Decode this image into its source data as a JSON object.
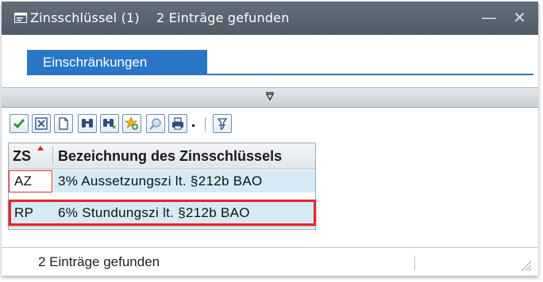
{
  "window": {
    "title": "Zinsschlüssel (1)    2 Einträge gefunden",
    "minimize_glyph": "—",
    "close_glyph": "✕"
  },
  "tabs": [
    {
      "label": "Einschränkungen"
    }
  ],
  "toolbar": {
    "buttons": [
      {
        "icon": "checkmark-icon"
      },
      {
        "icon": "cancel-icon"
      },
      {
        "icon": "new-document-icon"
      },
      {
        "icon": "find-icon"
      },
      {
        "icon": "find-next-icon"
      },
      {
        "icon": "favorite-add-icon"
      },
      {
        "icon": "help-icon"
      },
      {
        "icon": "print-icon"
      },
      {
        "icon": "dropdown-icon"
      },
      {
        "icon": "filter-icon"
      }
    ]
  },
  "table": {
    "columns": [
      "ZS",
      "Bezeichnung des Zinsschlüssels"
    ],
    "rows": [
      {
        "code": "AZ",
        "text": "3% Aussetzungszi lt. §212b BAO"
      },
      {
        "code": "RP",
        "text": "6% Stundungszi lt. §212b BAO"
      }
    ]
  },
  "status": {
    "text": "2 Einträge gefunden"
  },
  "colors": {
    "titlebar": "#56636e",
    "tab": "#2a76c6",
    "highlight": "#e8262a",
    "row_highlight": "#d5eaf5"
  }
}
